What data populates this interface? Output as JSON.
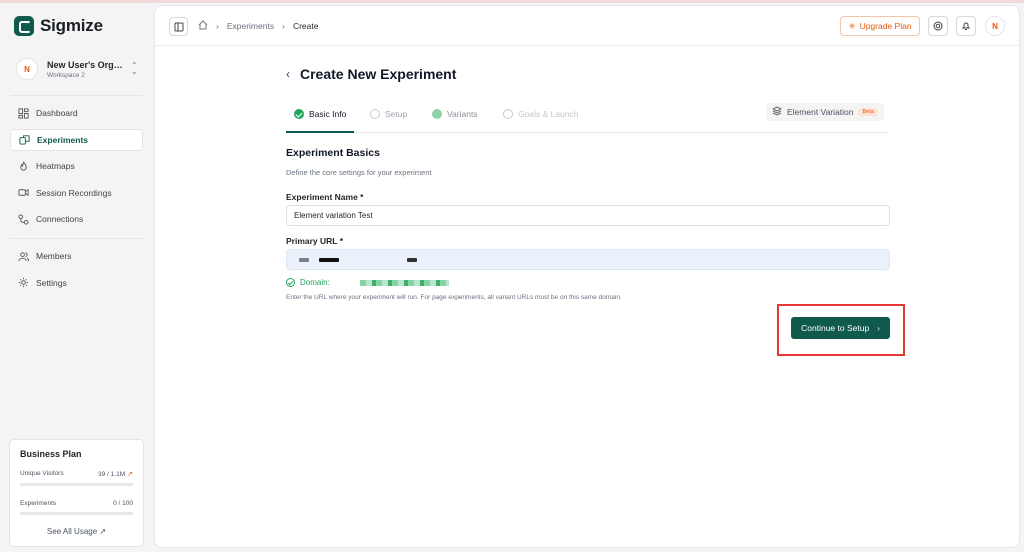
{
  "app": {
    "name": "Sigmize"
  },
  "org": {
    "avatar": "N",
    "name": "New User's Organ...",
    "workspace": "Workspace 2"
  },
  "sidebar": {
    "items": [
      {
        "label": "Dashboard",
        "icon": "dashboard-icon"
      },
      {
        "label": "Experiments",
        "icon": "experiments-icon"
      },
      {
        "label": "Heatmaps",
        "icon": "flame-icon"
      },
      {
        "label": "Session Recordings",
        "icon": "video-icon"
      },
      {
        "label": "Connections",
        "icon": "connections-icon"
      },
      {
        "label": "Members",
        "icon": "members-icon"
      },
      {
        "label": "Settings",
        "icon": "gear-icon"
      }
    ]
  },
  "plan": {
    "title": "Business Plan",
    "visitors_label": "Unique Visitors",
    "visitors_value": "39 / 1.1M",
    "experiments_label": "Experiments",
    "experiments_value": "0 / 100",
    "link": "See All Usage ↗"
  },
  "header": {
    "breadcrumbs": [
      "Experiments",
      "Create"
    ],
    "upgrade_label": "Upgrade Plan",
    "avatar": "N"
  },
  "page": {
    "title": "Create New Experiment",
    "tabs": [
      "Basic Info",
      "Setup",
      "Variants",
      "Goals & Launch"
    ],
    "element_variation": "Element Variation",
    "beta": "Beta",
    "section_title": "Experiment Basics",
    "section_subtitle": "Define the core settings for your experiment",
    "name_label": "Experiment Name *",
    "name_value": "Element variation Test",
    "url_label": "Primary URL *",
    "domain_label": "Domain:",
    "helper": "Enter the URL where your experiment will run. For page experiments, all variant URLs must be on this same domain.",
    "cta": "Continue to Setup"
  },
  "colors": {
    "brand": "#0f5a4c",
    "accent": "#e8590c",
    "success": "#22a35a",
    "highlight": "#e53935"
  }
}
